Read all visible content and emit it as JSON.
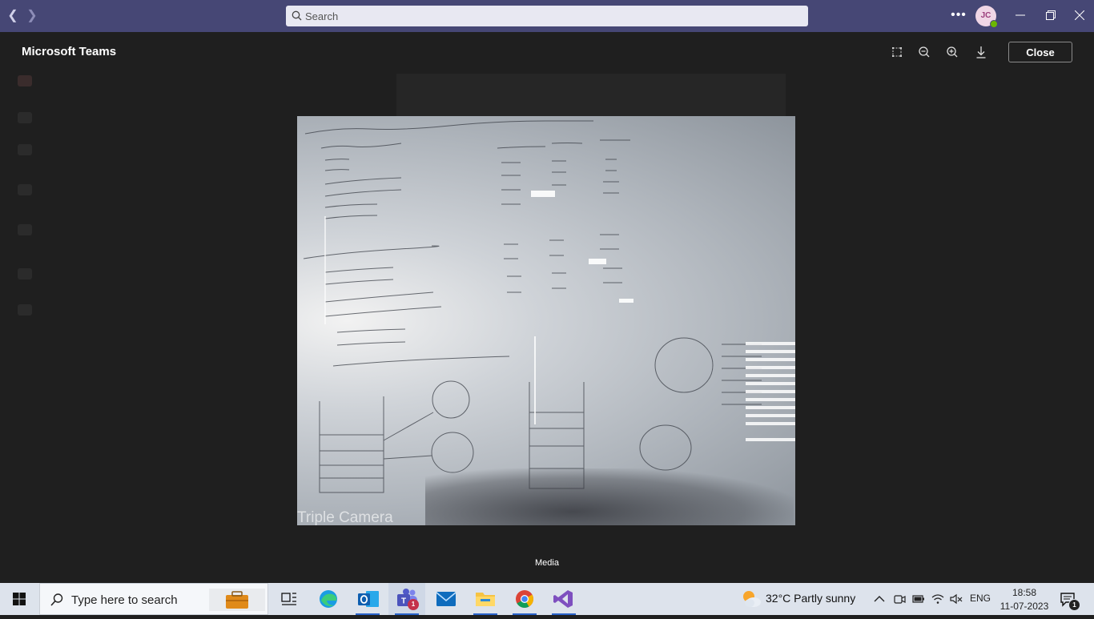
{
  "titlebar": {
    "search_placeholder": "Search",
    "avatar_initials": "JC",
    "accent": "#464775"
  },
  "viewer": {
    "app_title": "Microsoft Teams",
    "close_label": "Close",
    "caption": "Media",
    "tools": [
      "fit-screen-icon",
      "zoom-out-icon",
      "zoom-in-icon",
      "download-icon"
    ]
  },
  "photo": {
    "watermark": "Triple Camera"
  },
  "taskbar": {
    "search_placeholder": "Type here to search",
    "weather": "32°C  Partly sunny",
    "language": "ENG",
    "time": "18:58",
    "date": "11-07-2023",
    "teams_badge": "1",
    "notification_badge": "1",
    "apps": [
      "task-view-icon",
      "edge-icon",
      "outlook-icon",
      "teams-icon",
      "mail-icon",
      "file-explorer-icon",
      "chrome-icon",
      "visual-studio-icon"
    ]
  }
}
